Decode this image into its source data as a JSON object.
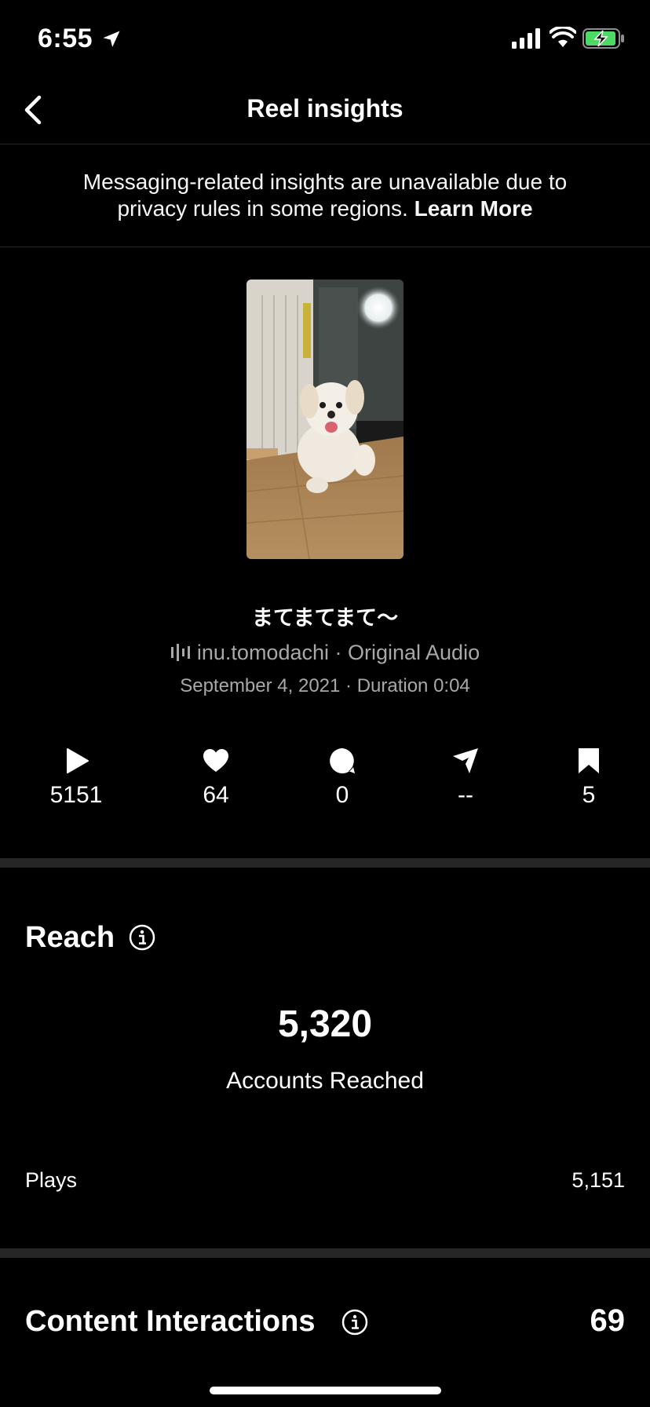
{
  "status_bar": {
    "time": "6:55"
  },
  "header": {
    "title": "Reel insights"
  },
  "notice": {
    "text": "Messaging-related insights are unavailable due to privacy rules in some regions.",
    "link": "Learn More"
  },
  "reel": {
    "caption": "まてまてまて〜",
    "audio": "inu.tomodachi · Original Audio",
    "meta": "September 4, 2021 · Duration 0:04"
  },
  "stats": {
    "plays": "5151",
    "likes": "64",
    "comments": "0",
    "shares": "--",
    "saves": "5"
  },
  "reach": {
    "title": "Reach",
    "accounts_reached_value": "5,320",
    "accounts_reached_label": "Accounts Reached",
    "plays_label": "Plays",
    "plays_value": "5,151"
  },
  "content_interactions": {
    "title": "Content Interactions",
    "value": "69"
  },
  "colors": {
    "background": "#000000",
    "divider": "#262626",
    "muted_text": "#a8a8a8",
    "battery_green": "#4cd964"
  }
}
